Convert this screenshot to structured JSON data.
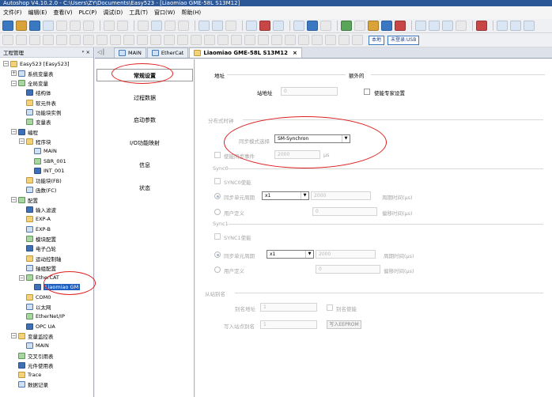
{
  "window": {
    "title": "Autoshop V4.10.2.0 - C:\\Users\\ZY\\Documents\\Easy523 - [Liaomiao GME-58L S13M12]"
  },
  "menu": [
    "文件(F)",
    "编辑(E)",
    "查看(V)",
    "PLC(P)",
    "调试(D)",
    "工具(T)",
    "窗口(W)",
    "帮助(H)"
  ],
  "toolbar2": {
    "local_label": "本地",
    "login_label": "未登录:USB"
  },
  "project_panel": {
    "title": "工程管理",
    "pin": "ᵖ ×"
  },
  "tree": [
    {
      "label": "Easy523 [Easy523]",
      "level": 0,
      "exp": "−"
    },
    {
      "label": "系统变量表",
      "level": 1,
      "exp": "+"
    },
    {
      "label": "全局变量",
      "level": 1,
      "exp": "−"
    },
    {
      "label": "结构体",
      "level": 2
    },
    {
      "label": "软元件表",
      "level": 2
    },
    {
      "label": "功能块实例",
      "level": 2
    },
    {
      "label": "变量表",
      "level": 2
    },
    {
      "label": "编程",
      "level": 1,
      "exp": "−"
    },
    {
      "label": "程序块",
      "level": 2,
      "exp": "−"
    },
    {
      "label": "MAIN",
      "level": 3
    },
    {
      "label": "SBR_001",
      "level": 3
    },
    {
      "label": "INT_001",
      "level": 3
    },
    {
      "label": "功能块(FB)",
      "level": 2
    },
    {
      "label": "函数(FC)",
      "level": 2
    },
    {
      "label": "配置",
      "level": 1,
      "exp": "−"
    },
    {
      "label": "输入滤波",
      "level": 2
    },
    {
      "label": "EXP-A",
      "level": 2
    },
    {
      "label": "EXP-B",
      "level": 2
    },
    {
      "label": "模块配置",
      "level": 2
    },
    {
      "label": "电子凸轮",
      "level": 2
    },
    {
      "label": "运动控制轴",
      "level": 2
    },
    {
      "label": "轴组配置",
      "level": 2
    },
    {
      "label": "EtherCAT",
      "level": 2,
      "exp": "−"
    },
    {
      "label": "Liaomiao GM",
      "level": 3,
      "selected": true
    },
    {
      "label": "COM0",
      "level": 2
    },
    {
      "label": "以太网",
      "level": 2
    },
    {
      "label": "EtherNet/IP",
      "level": 2
    },
    {
      "label": "OPC UA",
      "level": 2
    },
    {
      "label": "变量监控表",
      "level": 1,
      "exp": "−"
    },
    {
      "label": "MAIN",
      "level": 2
    },
    {
      "label": "交叉引用表",
      "level": 1
    },
    {
      "label": "元件使用表",
      "level": 1
    },
    {
      "label": "Trace",
      "level": 1
    },
    {
      "label": "数据记录",
      "level": 1
    }
  ],
  "tabs": {
    "ctl": "◁ ▏",
    "main": "MAIN",
    "ethercat": "EtherCat",
    "device": "Liaomiao GME-58L S13M12",
    "close": "×"
  },
  "nav": [
    "常规设置",
    "过程数据",
    "启动参数",
    "I/O功能映射",
    "信息",
    "状态"
  ],
  "content": {
    "address_section": "地址",
    "extra_section": "额外的",
    "station_addr_label": "站地址",
    "station_addr_value": "0",
    "expert_label": "使能专家设置",
    "dc_section": "分布式时钟",
    "sync_mode_label": "同步模式选择",
    "sync_mode_value": "SM-Synchron",
    "sync_event_label": "使能同步事件",
    "sync_event_value": "2000",
    "sync_event_unit": "μs",
    "sync0_section": "Sync0",
    "sync0_enable": "SYNC0使能",
    "sync0_unit_cycle": "同步单元周期",
    "sync0_mult": "x1",
    "sync0_cycle_value": "2000",
    "sync0_cycle_label": "周期时间(μs)",
    "sync0_user": "用户定义",
    "sync0_user_value": "0",
    "sync0_shift_label": "偏移时间(μs)",
    "sync1_section": "Sync1",
    "sync1_enable": "SYNC1使能",
    "sync1_unit_cycle": "同步单元周期",
    "sync1_mult": "x1",
    "sync1_cycle_value": "2000",
    "sync1_cycle_label": "周期时间(μs)",
    "sync1_user": "用户定义",
    "sync1_user_value": "0",
    "sync1_shift_label": "偏移时间(μs)",
    "alias_section": "从站别名",
    "alias_addr_label": "别名地址",
    "alias_addr_value": "1",
    "alias_enable_label": "别名使能",
    "write_alias_label": "写入站点别名",
    "write_alias_value": "1",
    "write_eeprom_button": "写入EEPROM"
  },
  "colors": {
    "title_bg": "#2b5797",
    "selection": "#1f5fbf",
    "annotation": "#e02020"
  }
}
